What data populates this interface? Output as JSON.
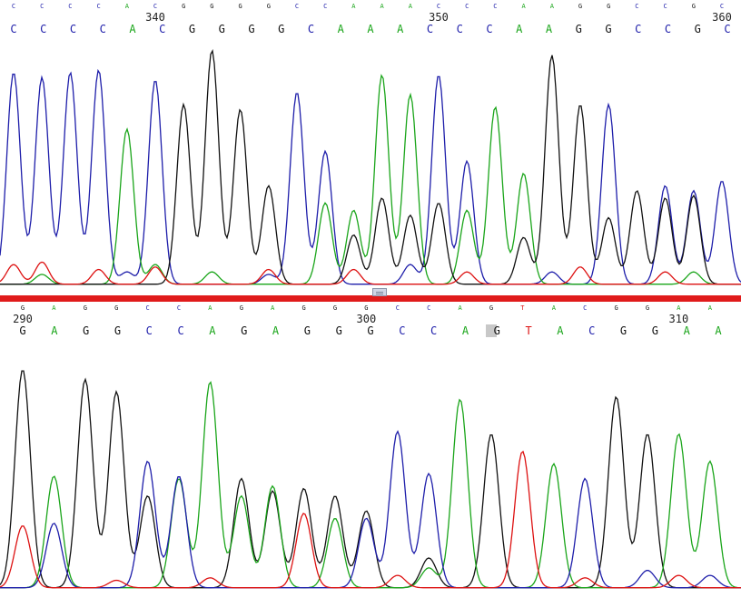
{
  "colors": {
    "A": "#1aa51a",
    "C": "#1e1eaa",
    "G": "#111111",
    "T": "#dd1111",
    "divider": "#e01b1b",
    "highlight": "#c8c8c8"
  },
  "chart_data": [
    {
      "type": "line",
      "panel": "top",
      "position_labels": [
        {
          "label": "340",
          "index": 5
        },
        {
          "label": "350",
          "index": 15
        },
        {
          "label": "360",
          "index": 25
        }
      ],
      "base_calls": [
        "C",
        "C",
        "C",
        "C",
        "A",
        "C",
        "G",
        "G",
        "G",
        "G",
        "C",
        "C",
        "A",
        "A",
        "A",
        "C",
        "C",
        "C",
        "A",
        "A",
        "G",
        "G",
        "C",
        "C",
        "G",
        "C"
      ],
      "called_sequence": [
        "C",
        "C",
        "C",
        "C",
        "A",
        "C",
        "G",
        "G",
        "G",
        "G",
        "C",
        "A",
        "A",
        "A",
        "C",
        "C",
        "C",
        "A",
        "A",
        "G",
        "G",
        "C",
        "C",
        "G",
        "C"
      ],
      "series": [
        {
          "base": "C",
          "peaks": [
            {
              "i": 0,
              "h": 0.86
            },
            {
              "i": 1,
              "h": 0.84
            },
            {
              "i": 2,
              "h": 0.86
            },
            {
              "i": 3,
              "h": 0.87
            },
            {
              "i": 5,
              "h": 0.83
            },
            {
              "i": 10,
              "h": 0.78
            },
            {
              "i": 11,
              "h": 0.54
            },
            {
              "i": 15,
              "h": 0.85
            },
            {
              "i": 16,
              "h": 0.5
            },
            {
              "i": 21,
              "h": 0.73
            },
            {
              "i": 23,
              "h": 0.4
            },
            {
              "i": 24,
              "h": 0.38
            },
            {
              "i": 25,
              "h": 0.42
            },
            {
              "i": 4,
              "h": 0.05
            },
            {
              "i": 9,
              "h": 0.04
            },
            {
              "i": 14,
              "h": 0.08
            },
            {
              "i": 19,
              "h": 0.05
            }
          ]
        },
        {
          "base": "A",
          "peaks": [
            {
              "i": 4,
              "h": 0.63
            },
            {
              "i": 11,
              "h": 0.33
            },
            {
              "i": 12,
              "h": 0.3
            },
            {
              "i": 13,
              "h": 0.85
            },
            {
              "i": 14,
              "h": 0.77
            },
            {
              "i": 16,
              "h": 0.3
            },
            {
              "i": 17,
              "h": 0.72
            },
            {
              "i": 18,
              "h": 0.45
            },
            {
              "i": 5,
              "h": 0.08
            },
            {
              "i": 1,
              "h": 0.04
            },
            {
              "i": 7,
              "h": 0.05
            },
            {
              "i": 24,
              "h": 0.05
            }
          ]
        },
        {
          "base": "G",
          "peaks": [
            {
              "i": 6,
              "h": 0.73
            },
            {
              "i": 7,
              "h": 0.95
            },
            {
              "i": 8,
              "h": 0.71
            },
            {
              "i": 9,
              "h": 0.4
            },
            {
              "i": 12,
              "h": 0.2
            },
            {
              "i": 13,
              "h": 0.35
            },
            {
              "i": 14,
              "h": 0.28
            },
            {
              "i": 15,
              "h": 0.33
            },
            {
              "i": 18,
              "h": 0.19
            },
            {
              "i": 19,
              "h": 0.93
            },
            {
              "i": 20,
              "h": 0.73
            },
            {
              "i": 22,
              "h": 0.38
            },
            {
              "i": 23,
              "h": 0.35
            },
            {
              "i": 24,
              "h": 0.36
            },
            {
              "i": 21,
              "h": 0.27
            }
          ]
        },
        {
          "base": "T",
          "peaks": [
            {
              "i": 0,
              "h": 0.08
            },
            {
              "i": 1,
              "h": 0.09
            },
            {
              "i": 3,
              "h": 0.06
            },
            {
              "i": 5,
              "h": 0.07
            },
            {
              "i": 9,
              "h": 0.06
            },
            {
              "i": 12,
              "h": 0.06
            },
            {
              "i": 16,
              "h": 0.05
            },
            {
              "i": 20,
              "h": 0.07
            },
            {
              "i": 23,
              "h": 0.05
            }
          ]
        }
      ]
    },
    {
      "type": "line",
      "panel": "bottom",
      "position_labels": [
        {
          "label": "290",
          "index": 0
        },
        {
          "label": "300",
          "index": 11
        },
        {
          "label": "310",
          "index": 21
        }
      ],
      "base_calls": [
        "G",
        "A",
        "G",
        "G",
        "C",
        "C",
        "A",
        "G",
        "A",
        "G",
        "G",
        "G",
        "C",
        "C",
        "A",
        "G",
        "T",
        "A",
        "C",
        "G",
        "G",
        "A",
        "A"
      ],
      "called_sequence": [
        "G",
        "A",
        "G",
        "G",
        "C",
        "C",
        "A",
        "G",
        "A",
        "G",
        "G",
        "G",
        "C",
        "C",
        "A",
        "G",
        "T",
        "A",
        "C",
        "G",
        "G",
        "A",
        "A"
      ],
      "highlight_index": 15,
      "series": [
        {
          "base": "G",
          "peaks": [
            {
              "i": 0,
              "h": 0.88
            },
            {
              "i": 2,
              "h": 0.84
            },
            {
              "i": 3,
              "h": 0.79
            },
            {
              "i": 4,
              "h": 0.37
            },
            {
              "i": 7,
              "h": 0.44
            },
            {
              "i": 8,
              "h": 0.39
            },
            {
              "i": 9,
              "h": 0.4
            },
            {
              "i": 10,
              "h": 0.37
            },
            {
              "i": 11,
              "h": 0.31
            },
            {
              "i": 13,
              "h": 0.12
            },
            {
              "i": 15,
              "h": 0.62
            },
            {
              "i": 19,
              "h": 0.77
            },
            {
              "i": 20,
              "h": 0.62
            }
          ]
        },
        {
          "base": "A",
          "peaks": [
            {
              "i": 1,
              "h": 0.45
            },
            {
              "i": 5,
              "h": 0.44
            },
            {
              "i": 6,
              "h": 0.83
            },
            {
              "i": 7,
              "h": 0.37
            },
            {
              "i": 8,
              "h": 0.41
            },
            {
              "i": 10,
              "h": 0.28
            },
            {
              "i": 14,
              "h": 0.76
            },
            {
              "i": 17,
              "h": 0.5
            },
            {
              "i": 21,
              "h": 0.62
            },
            {
              "i": 22,
              "h": 0.51
            },
            {
              "i": 13,
              "h": 0.08
            }
          ]
        },
        {
          "base": "C",
          "peaks": [
            {
              "i": 1,
              "h": 0.26
            },
            {
              "i": 4,
              "h": 0.51
            },
            {
              "i": 5,
              "h": 0.45
            },
            {
              "i": 11,
              "h": 0.28
            },
            {
              "i": 12,
              "h": 0.63
            },
            {
              "i": 13,
              "h": 0.46
            },
            {
              "i": 18,
              "h": 0.44
            },
            {
              "i": 20,
              "h": 0.07
            },
            {
              "i": 22,
              "h": 0.05
            }
          ]
        },
        {
          "base": "T",
          "peaks": [
            {
              "i": 0,
              "h": 0.25
            },
            {
              "i": 9,
              "h": 0.3
            },
            {
              "i": 16,
              "h": 0.55
            },
            {
              "i": 6,
              "h": 0.04
            },
            {
              "i": 12,
              "h": 0.05
            },
            {
              "i": 18,
              "h": 0.04
            },
            {
              "i": 21,
              "h": 0.05
            },
            {
              "i": 3,
              "h": 0.03
            }
          ]
        }
      ]
    }
  ]
}
